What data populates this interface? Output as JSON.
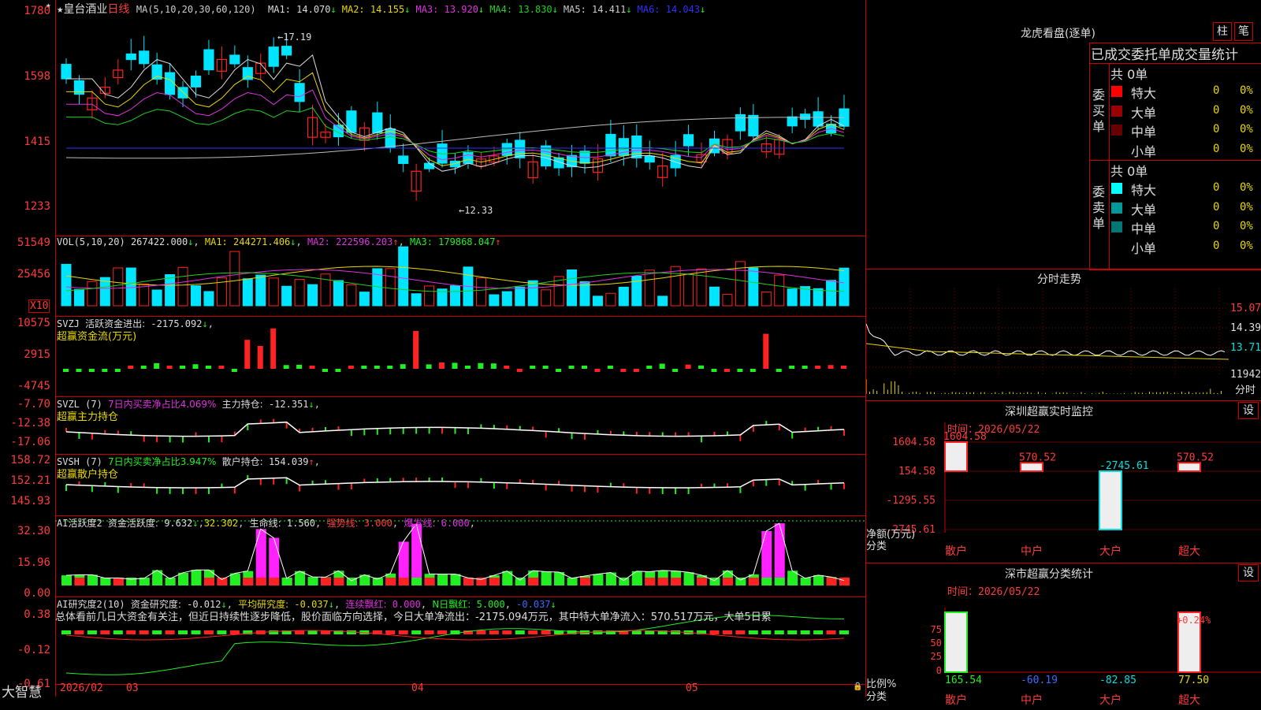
{
  "stock": {
    "name": "皇台酒业",
    "period": "日线",
    "star": "★"
  },
  "price_panel": {
    "ma_header": "MA(5,10,20,30,60,120)",
    "ma_values": [
      {
        "label": "MA1:",
        "value": "14.070",
        "arrow": "↓",
        "color": "#dcdcdc"
      },
      {
        "label": "MA2:",
        "value": "14.155",
        "arrow": "↓",
        "color": "#e8d800"
      },
      {
        "label": "MA3:",
        "value": "13.920",
        "arrow": "↓",
        "color": "#e030e0"
      },
      {
        "label": "MA4:",
        "value": "13.830",
        "arrow": "↓",
        "color": "#20d020"
      },
      {
        "label": "MA5:",
        "value": "14.411",
        "arrow": "↓",
        "color": "#cccccc"
      },
      {
        "label": "MA6:",
        "value": "14.043",
        "arrow": "↓",
        "color": "#3030ff"
      }
    ],
    "y_ticks": [
      "1780",
      "1598",
      "1415",
      "1233"
    ],
    "high_mark": "17.19",
    "low_mark": "←12.33",
    "high_prefix": "←"
  },
  "vol_panel": {
    "header": "VOL(5,10,20)",
    "value": "267422.000",
    "ma1": "244271.406",
    "ma2": "222596.203",
    "ma3": "179868.047",
    "ma1_label": "MA1:",
    "ma2_label": "MA2:",
    "ma3_label": "MA3:",
    "arrow_down": "↓",
    "arrow_up": "↑",
    "y_ticks": [
      "51549",
      "25456"
    ],
    "unit": "X10"
  },
  "svzj_panel": {
    "name": "SVZJ",
    "title": "活跃资金进出:",
    "value": "-2175.092",
    "arrow": "↓",
    "sub": "超赢资金流(万元)",
    "y_ticks": [
      "10575",
      "2915",
      "-4745"
    ]
  },
  "svzl_panel": {
    "name": "SVZL (7)",
    "desc": "7日内买卖净占比4.069%",
    "label": "主力持仓:",
    "value": "-12.351",
    "arrow": "↓",
    "sub": "超赢主力持仓",
    "y_ticks": [
      "-7.70",
      "-12.38",
      "-17.06"
    ]
  },
  "svsh_panel": {
    "name": "SVSH (7)",
    "desc": "7日内买卖净占比3.947%",
    "label": "散户持仓:",
    "value": "154.039",
    "arrow": "↑",
    "sub": "超赢散户持仓",
    "y_ticks": [
      "158.72",
      "152.21",
      "145.93"
    ]
  },
  "ai_active_panel": {
    "name": "AI活跃度2",
    "label": "资金活跃度:",
    "value": "9.632",
    "arrow": "↓",
    "value2": "32.302",
    "life_label": "生命线:",
    "life_value": "1.560",
    "strong_label": "强势线:",
    "strong_value": "3.000",
    "burst_label": "爆发线:",
    "burst_value": "6.000",
    "y_ticks": [
      "32.30",
      "15.96",
      "0.00"
    ]
  },
  "ai_research_panel": {
    "name": "AI研究度2(10)",
    "label": "资金研究度:",
    "value": "-0.012",
    "arrow": "↓",
    "avg_label": "平均研究度:",
    "avg_value": "-0.037",
    "red_label": "连续飘红:",
    "red_value": "0.000",
    "nred_label": "N日飘红:",
    "nred_value": "5.000",
    "extra_value": "-0.037",
    "summary": "总体看前几日大资金有关注，但近日持续性逐步降低，股价面临方向选择，今日大单净流出：-2175.094万元，其中特大单净流入：570.517万元，大单5日累",
    "y_ticks": [
      "0.38",
      "-0.12",
      "-0.61"
    ]
  },
  "x_axis": {
    "labels": [
      "2026/02",
      "03",
      "04",
      "05"
    ],
    "lock": "🔒"
  },
  "brand": "大智慧",
  "right": {
    "dragon_title": "龙虎看盘(逐单)",
    "btn_zhu": "柱",
    "btn_bi": "笔",
    "stat_title": "已成交委托单成交量统计",
    "buy_header": "共 0单",
    "buy_side_label": "委买单",
    "sell_header": "共 0单",
    "sell_side_label": "委卖单",
    "buy_rows": [
      {
        "name": "特大",
        "count": "0",
        "pct": "0%",
        "color": "#ff0000"
      },
      {
        "name": "大单",
        "count": "0",
        "pct": "0%",
        "color": "#990000"
      },
      {
        "name": "中单",
        "count": "0",
        "pct": "0%",
        "color": "#660000"
      },
      {
        "name": "小单",
        "count": "0",
        "pct": "0%",
        "color": ""
      }
    ],
    "sell_rows": [
      {
        "name": "特大",
        "count": "0",
        "pct": "0%",
        "color": "#00ffff"
      },
      {
        "name": "大单",
        "count": "0",
        "pct": "0%",
        "color": "#009999"
      },
      {
        "name": "中单",
        "count": "0",
        "pct": "0%",
        "color": "#007777"
      },
      {
        "name": "小单",
        "count": "0",
        "pct": "0%",
        "color": ""
      }
    ],
    "intraday_title": "分时走势",
    "intraday_ticks": [
      "15.07",
      "14.39",
      "13.71"
    ],
    "intraday_vol": "11942",
    "intraday_unit": "分时",
    "sz_monitor_title": "深圳超赢实时监控",
    "settings": "设",
    "time_label": "时间：",
    "date": "2026/05/22",
    "monitor_ticks": [
      "1604.58",
      "154.58",
      "-1295.55",
      "-2745.61"
    ],
    "monitor_bars": [
      {
        "cat": "散户",
        "value": "1604.58"
      },
      {
        "cat": "中户",
        "value": "570.52"
      },
      {
        "cat": "大户",
        "value": "-2745.61"
      },
      {
        "cat": "超大",
        "value": "570.52"
      }
    ],
    "net_label": "净额(万元)",
    "cat_label": "分类",
    "sz_class_title": "深市超赢分类统计",
    "class_ticks": [
      "75",
      "50",
      "25",
      "0"
    ],
    "class_top_label": "+0.24%",
    "class_bars": [
      {
        "cat": "散户",
        "value": "165.54",
        "color": "#22ee22"
      },
      {
        "cat": "中户",
        "value": "-60.19",
        "color": "#3a6bff"
      },
      {
        "cat": "大户",
        "value": "-82.85",
        "color": "#00e0e0"
      },
      {
        "cat": "超大",
        "value": "77.50",
        "color": "#e8d800"
      }
    ],
    "ratio_label": "比例%"
  }
}
